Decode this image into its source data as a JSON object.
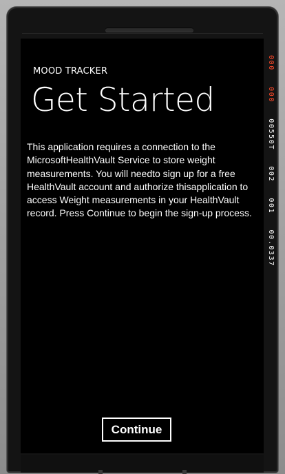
{
  "app": {
    "name": "MOOD TRACKER",
    "page_title": "Get Started",
    "description": "This application requires a connection to the MicrosoftHealthVault Service to store weight measurements. You will needto sign up for a free HealthVault account and authorize thisapplication to access Weight measurements in your HealthVault record. Press Continue to begin the sign-up process.",
    "continue_label": "Continue"
  },
  "perf_counters": {
    "counter_1": "000",
    "counter_2": "000",
    "counter_3": "00550T",
    "counter_4": "002",
    "counter_5": "001",
    "counter_6": "00.0337",
    "colors": {
      "warning": "#ff4a2a",
      "normal": "#ffffff"
    }
  },
  "colors": {
    "screen_background": "#000000",
    "text": "#ffffff",
    "device_frame": "#9a9a9a",
    "bezel": "#141414"
  }
}
